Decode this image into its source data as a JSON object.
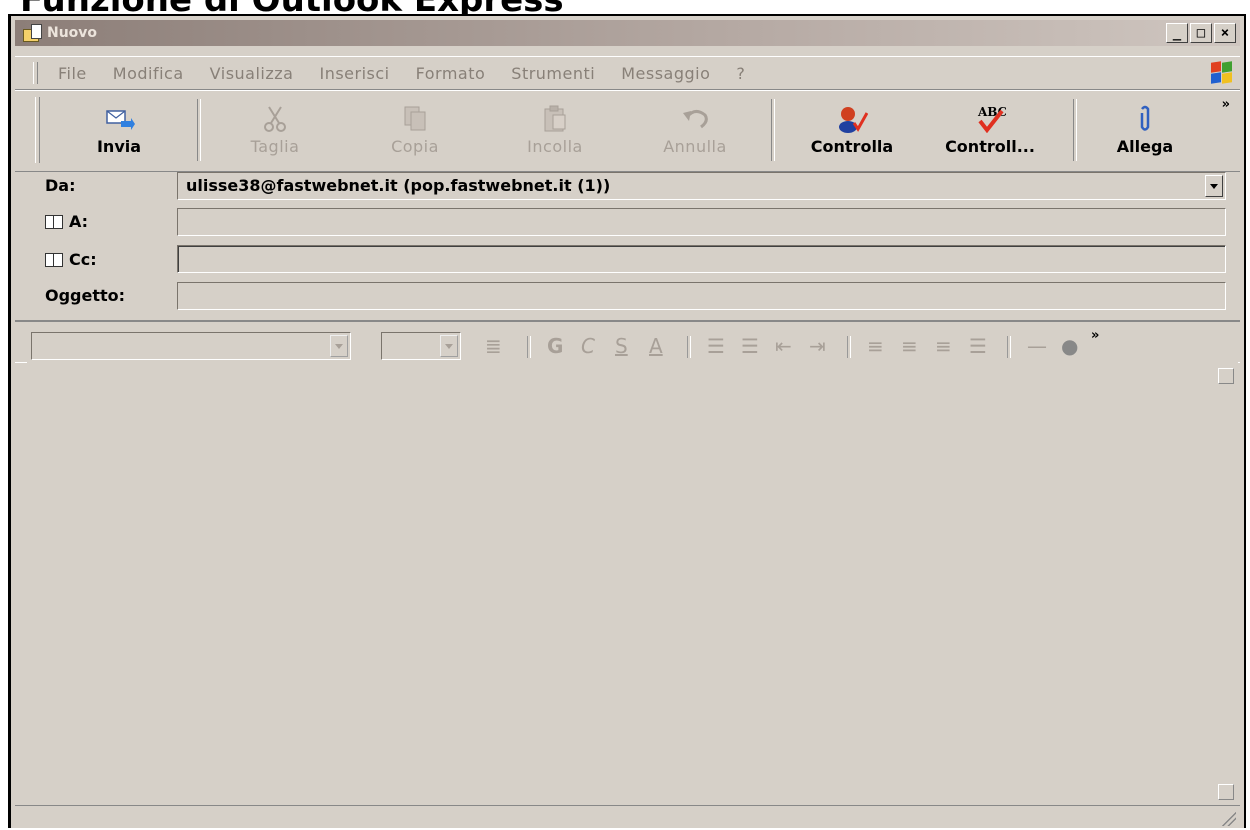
{
  "cut_heading": "Funzione di Outlook Express",
  "window": {
    "title": "Nuovo",
    "controls": {
      "minimize": "_",
      "maximize": "□",
      "close": "×"
    }
  },
  "menu": {
    "items": [
      "File",
      "Modifica",
      "Visualizza",
      "Inserisci",
      "Formato",
      "Strumenti",
      "Messaggio",
      "?"
    ]
  },
  "toolbar": {
    "buttons": [
      {
        "label": "Invia",
        "icon": "send-icon",
        "enabled": true
      },
      {
        "label": "Taglia",
        "icon": "scissors-icon",
        "enabled": false
      },
      {
        "label": "Copia",
        "icon": "copy-icon",
        "enabled": false
      },
      {
        "label": "Incolla",
        "icon": "paste-icon",
        "enabled": false
      },
      {
        "label": "Annulla",
        "icon": "undo-icon",
        "enabled": false
      },
      {
        "label": "Controlla",
        "icon": "check-names-icon",
        "enabled": true
      },
      {
        "label": "Controll...",
        "icon": "spellcheck-icon",
        "icon_text": "ABC",
        "enabled": true
      },
      {
        "label": "Allega",
        "icon": "paperclip-icon",
        "enabled": true
      }
    ],
    "more": "»"
  },
  "fields": {
    "from_label": "Da:",
    "from_value": "ulisse38@fastwebnet.it     (pop.fastwebnet.it (1))",
    "to_label": "A:",
    "to_value": "",
    "cc_label": "Cc:",
    "cc_value": "",
    "subject_label": "Oggetto:",
    "subject_value": ""
  },
  "format_toolbar": {
    "font_value": "",
    "size_value": "",
    "buttons": [
      "G",
      "C",
      "S",
      "A"
    ],
    "more": "»"
  },
  "colors": {
    "face": "#d6d0c8",
    "disabled_text": "#a8a098",
    "title_bar": "#8c7e78"
  }
}
